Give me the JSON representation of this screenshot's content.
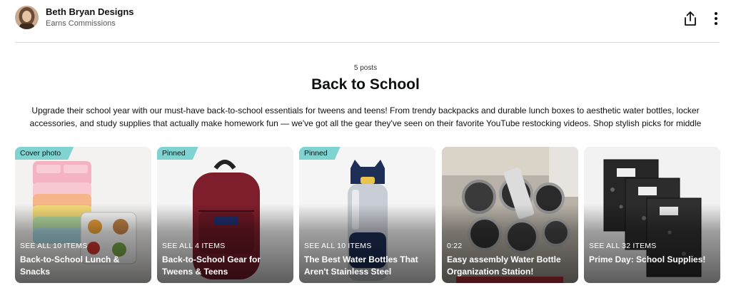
{
  "header": {
    "creator_name": "Beth Bryan Designs",
    "creator_subtitle": "Earns Commissions",
    "share_icon": "share-icon",
    "more_icon": "more-vertical-icon"
  },
  "list": {
    "post_count": "5 posts",
    "title": "Back to School",
    "description": "Upgrade their school year with our must-have back-to-school essentials for tweens and teens! From trendy backpacks and durable lunch boxes to aesthetic water bottles, locker accessories, and study supplies that actually make homework fun — we've got all the gear they've seen on their favorite YouTube restocking videos. Shop stylish picks for middle"
  },
  "cards": [
    {
      "tag": "Cover photo",
      "see_all": "SEE ALL 10 ITEMS",
      "title": "Back-to-School Lunch & Snacks"
    },
    {
      "tag": "Pinned",
      "see_all": "SEE ALL 4 ITEMS",
      "title": "Back-to-School Gear for Tweens & Teens"
    },
    {
      "tag": "Pinned",
      "see_all": "SEE ALL 10 ITEMS",
      "title": "The Best Water Bottles That Aren't Stainless Steel"
    },
    {
      "tag": "",
      "see_all": "0:22",
      "title": "Easy assembly Water Bottle Organization Station!"
    },
    {
      "tag": "",
      "see_all": "SEE ALL 32 ITEMS",
      "title": "Prime Day: School Supplies!"
    }
  ],
  "colors": {
    "tag_bg": "#7fd3d1",
    "text": "#0f1111",
    "muted": "#565959"
  }
}
